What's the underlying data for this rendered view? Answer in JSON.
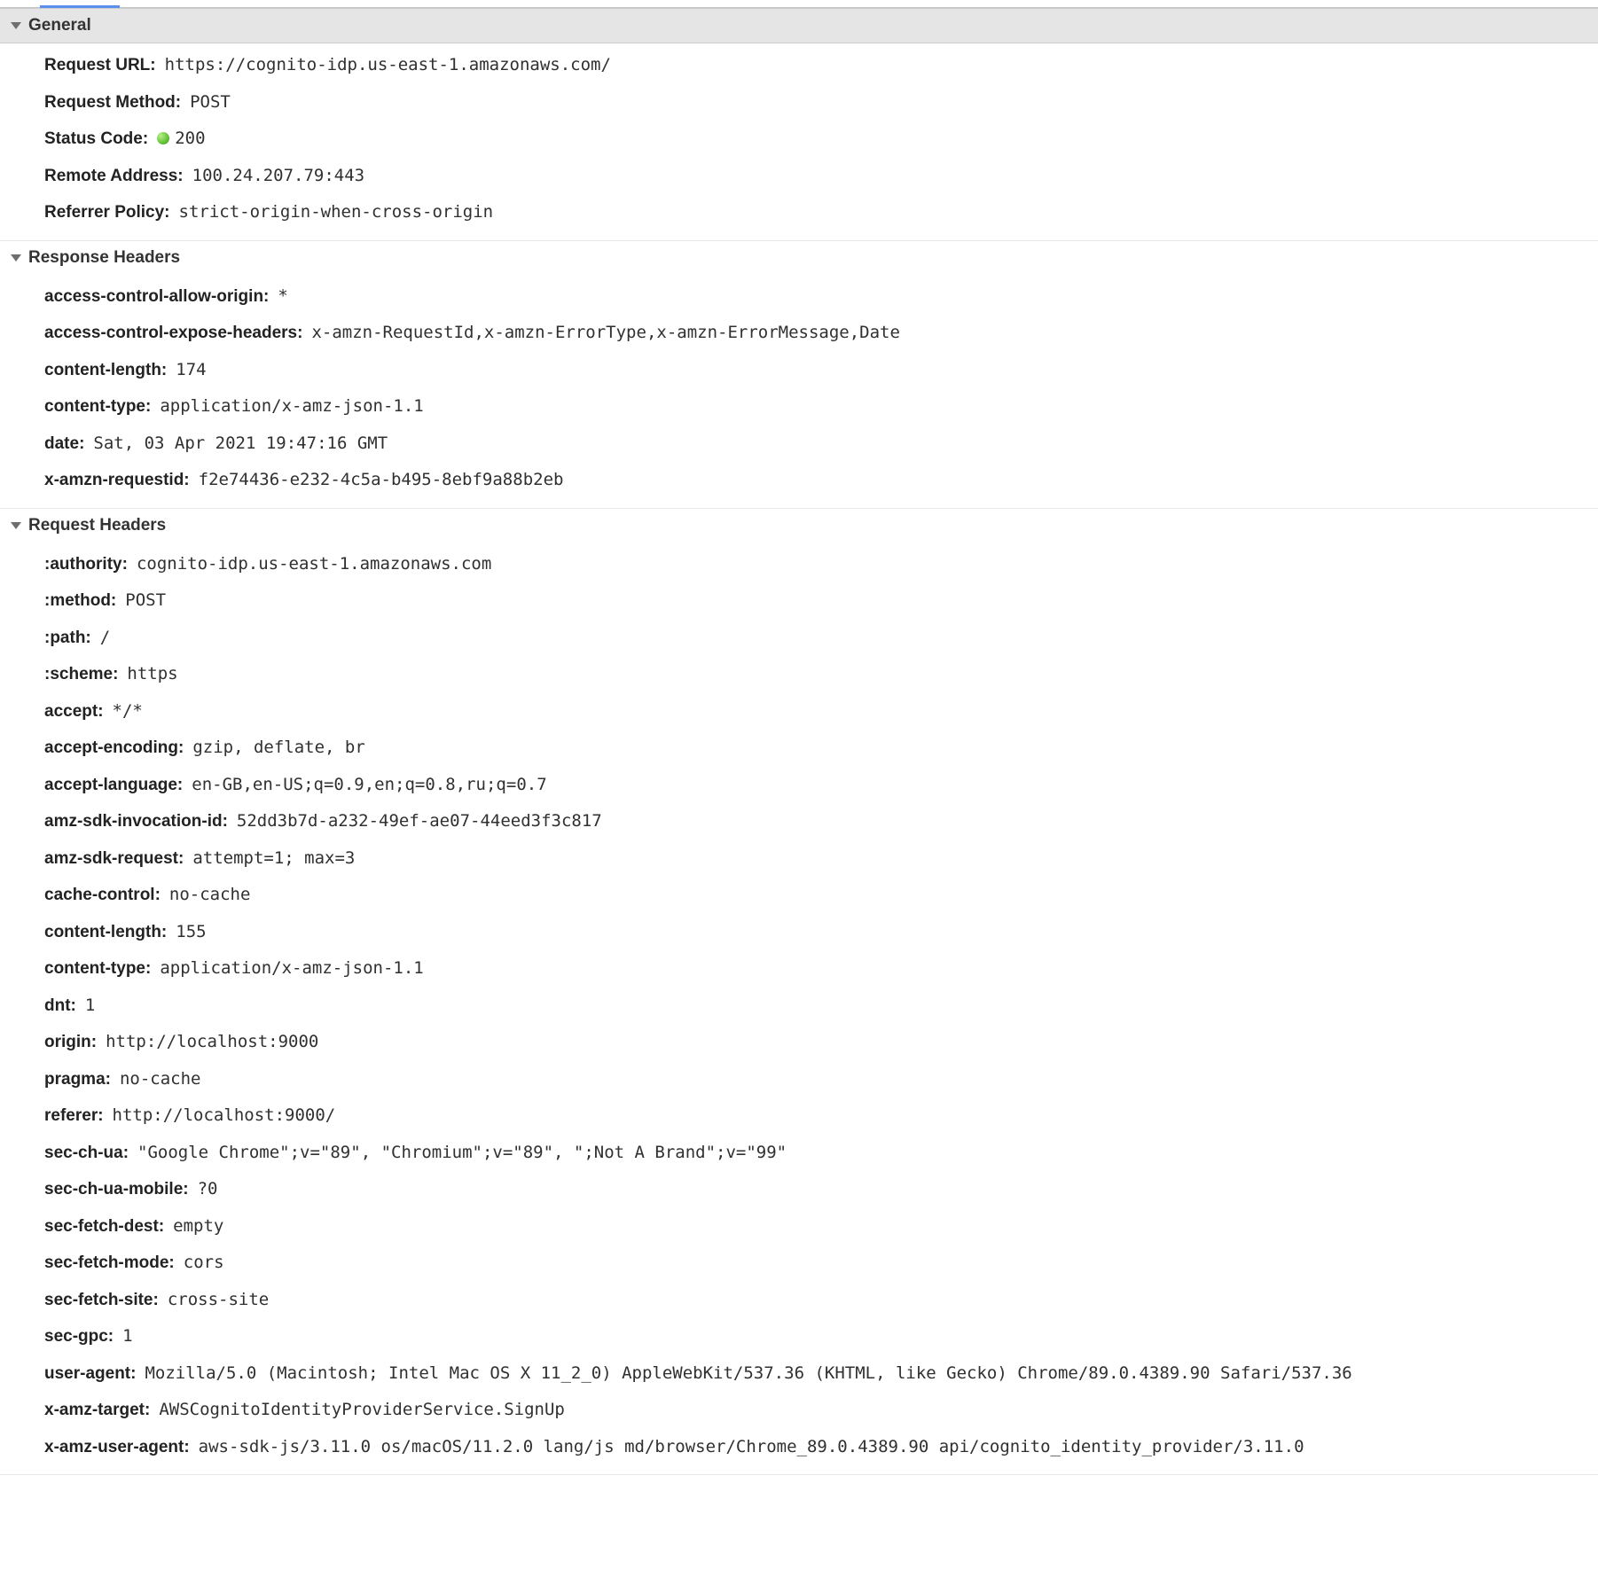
{
  "sections": {
    "general": {
      "title": "General",
      "rows": [
        {
          "label": "Request URL:",
          "value": "https://cognito-idp.us-east-1.amazonaws.com/"
        },
        {
          "label": "Request Method:",
          "value": "POST"
        },
        {
          "label": "Status Code:",
          "value": "200",
          "status_dot": true
        },
        {
          "label": "Remote Address:",
          "value": "100.24.207.79:443"
        },
        {
          "label": "Referrer Policy:",
          "value": "strict-origin-when-cross-origin"
        }
      ]
    },
    "response_headers": {
      "title": "Response Headers",
      "rows": [
        {
          "label": "access-control-allow-origin:",
          "value": "*"
        },
        {
          "label": "access-control-expose-headers:",
          "value": "x-amzn-RequestId,x-amzn-ErrorType,x-amzn-ErrorMessage,Date"
        },
        {
          "label": "content-length:",
          "value": "174"
        },
        {
          "label": "content-type:",
          "value": "application/x-amz-json-1.1"
        },
        {
          "label": "date:",
          "value": "Sat, 03 Apr 2021 19:47:16 GMT"
        },
        {
          "label": "x-amzn-requestid:",
          "value": "f2e74436-e232-4c5a-b495-8ebf9a88b2eb"
        }
      ]
    },
    "request_headers": {
      "title": "Request Headers",
      "rows": [
        {
          "label": ":authority:",
          "value": "cognito-idp.us-east-1.amazonaws.com"
        },
        {
          "label": ":method:",
          "value": "POST"
        },
        {
          "label": ":path:",
          "value": "/"
        },
        {
          "label": ":scheme:",
          "value": "https"
        },
        {
          "label": "accept:",
          "value": "*/*"
        },
        {
          "label": "accept-encoding:",
          "value": "gzip, deflate, br"
        },
        {
          "label": "accept-language:",
          "value": "en-GB,en-US;q=0.9,en;q=0.8,ru;q=0.7"
        },
        {
          "label": "amz-sdk-invocation-id:",
          "value": "52dd3b7d-a232-49ef-ae07-44eed3f3c817"
        },
        {
          "label": "amz-sdk-request:",
          "value": "attempt=1; max=3"
        },
        {
          "label": "cache-control:",
          "value": "no-cache"
        },
        {
          "label": "content-length:",
          "value": "155"
        },
        {
          "label": "content-type:",
          "value": "application/x-amz-json-1.1"
        },
        {
          "label": "dnt:",
          "value": "1"
        },
        {
          "label": "origin:",
          "value": "http://localhost:9000"
        },
        {
          "label": "pragma:",
          "value": "no-cache"
        },
        {
          "label": "referer:",
          "value": "http://localhost:9000/"
        },
        {
          "label": "sec-ch-ua:",
          "value": "\"Google Chrome\";v=\"89\", \"Chromium\";v=\"89\", \";Not A Brand\";v=\"99\""
        },
        {
          "label": "sec-ch-ua-mobile:",
          "value": "?0"
        },
        {
          "label": "sec-fetch-dest:",
          "value": "empty"
        },
        {
          "label": "sec-fetch-mode:",
          "value": "cors"
        },
        {
          "label": "sec-fetch-site:",
          "value": "cross-site"
        },
        {
          "label": "sec-gpc:",
          "value": "1"
        },
        {
          "label": "user-agent:",
          "value": "Mozilla/5.0 (Macintosh; Intel Mac OS X 11_2_0) AppleWebKit/537.36 (KHTML, like Gecko) Chrome/89.0.4389.90 Safari/537.36"
        },
        {
          "label": "x-amz-target:",
          "value": "AWSCognitoIdentityProviderService.SignUp"
        },
        {
          "label": "x-amz-user-agent:",
          "value": "aws-sdk-js/3.11.0 os/macOS/11.2.0 lang/js md/browser/Chrome_89.0.4389.90 api/cognito_identity_provider/3.11.0"
        }
      ]
    }
  }
}
